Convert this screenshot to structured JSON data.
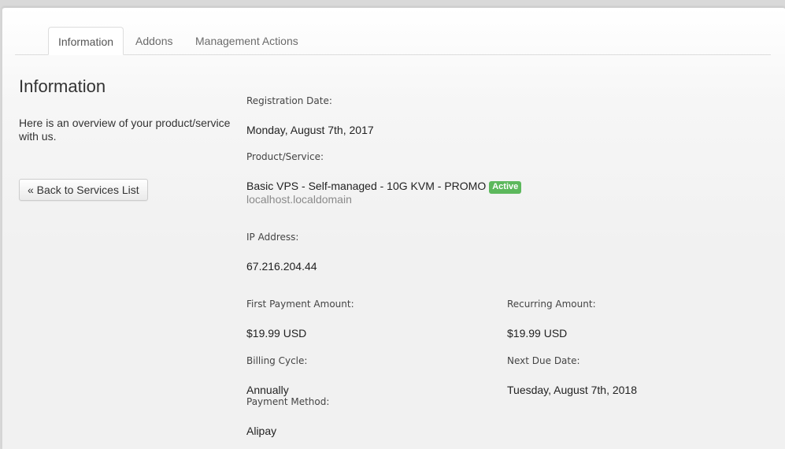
{
  "tabs": [
    {
      "label": "Information",
      "active": true
    },
    {
      "label": "Addons",
      "active": false
    },
    {
      "label": "Management Actions",
      "active": false
    }
  ],
  "sidebar": {
    "heading": "Information",
    "description": "Here is an overview of your product/service with us.",
    "back_button": "« Back to Services List"
  },
  "details": {
    "registration_date": {
      "label": "Registration Date:",
      "value": "Monday, August 7th, 2017"
    },
    "product": {
      "label": "Product/Service:",
      "name": "Basic VPS - Self-managed - 10G KVM - PROMO",
      "status": "Active",
      "hostname": "localhost.localdomain"
    },
    "ip_address": {
      "label": "IP Address:",
      "value": "67.216.204.44"
    },
    "first_payment": {
      "label": "First Payment Amount:",
      "value": "$19.99 USD"
    },
    "recurring": {
      "label": "Recurring Amount:",
      "value": "$19.99 USD"
    },
    "billing_cycle": {
      "label": "Billing Cycle:",
      "value": "Annually"
    },
    "next_due": {
      "label": "Next Due Date:",
      "value": "Tuesday, August 7th, 2018"
    },
    "payment_method": {
      "label": "Payment Method:",
      "value": "Alipay"
    }
  },
  "colors": {
    "status_active": "#5cb85c"
  }
}
